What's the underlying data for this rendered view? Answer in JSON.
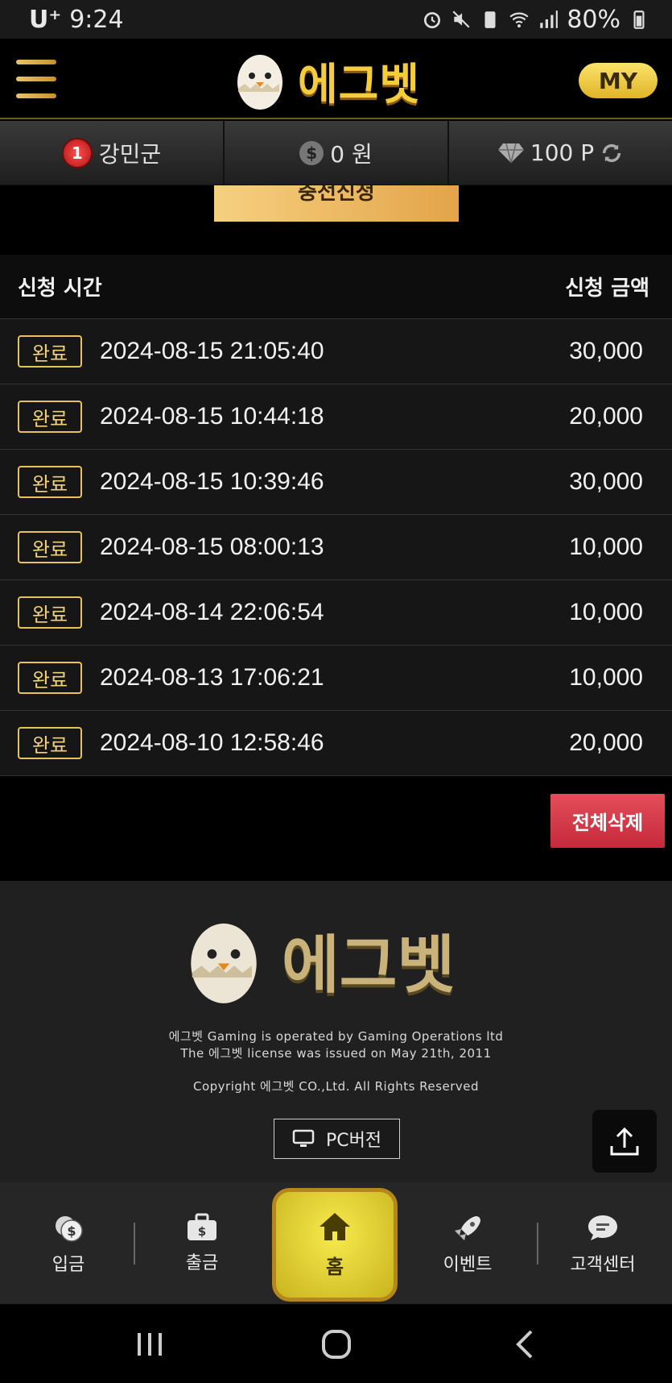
{
  "status_bar": {
    "carrier": "U⁺",
    "time": "9:24",
    "battery": "80%"
  },
  "header": {
    "logo_text": "에그벳",
    "my_label": "MY"
  },
  "user_bar": {
    "level": "1",
    "username": "강민군",
    "balance": "0 원",
    "points": "100 P"
  },
  "partial_button": {
    "label": "충전신청"
  },
  "history_table": {
    "col_time": "신청 시간",
    "col_amount": "신청 금액",
    "rows": [
      {
        "status": "완료",
        "datetime": "2024-08-15 21:05:40",
        "amount": "30,000"
      },
      {
        "status": "완료",
        "datetime": "2024-08-15 10:44:18",
        "amount": "20,000"
      },
      {
        "status": "완료",
        "datetime": "2024-08-15 10:39:46",
        "amount": "30,000"
      },
      {
        "status": "완료",
        "datetime": "2024-08-15 08:00:13",
        "amount": "10,000"
      },
      {
        "status": "완료",
        "datetime": "2024-08-14 22:06:54",
        "amount": "10,000"
      },
      {
        "status": "완료",
        "datetime": "2024-08-13 17:06:21",
        "amount": "10,000"
      },
      {
        "status": "완료",
        "datetime": "2024-08-10 12:58:46",
        "amount": "20,000"
      }
    ]
  },
  "delete_all_label": "전체삭제",
  "footer": {
    "logo_text": "에그벳",
    "line1": "에그벳 Gaming is operated by Gaming Operations ltd",
    "line2": "The 에그벳 license was issued on May 21th, 2011",
    "copyright": "Copyright 에그벳 CO.,Ltd. All Rights Reserved",
    "pc_label": "PC버전"
  },
  "bottom_nav": {
    "deposit": "입금",
    "withdraw": "출금",
    "home": "홈",
    "event": "이벤트",
    "support": "고객센터"
  },
  "colors": {
    "gold": "#f4cc3c",
    "status_border": "#e8c25c",
    "delete_red": "#d93a49",
    "home_yellow": "#eedc3a"
  }
}
